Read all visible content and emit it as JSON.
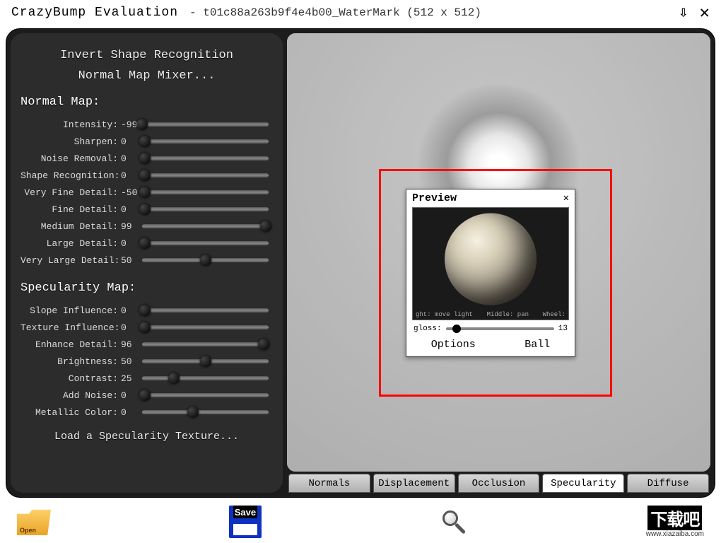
{
  "title": {
    "app": "CrazyBump Evaluation",
    "file": "- t01c88a263b9f4e4b00_WaterMark (512 x 512)"
  },
  "left": {
    "btn_invert": "Invert Shape Recognition",
    "btn_mixer": "Normal Map Mixer...",
    "section_normal": "Normal Map:",
    "section_spec": "Specularity Map:",
    "load_tex": "Load a Specularity Texture...",
    "normal_sliders": [
      {
        "label": "Intensity:",
        "val": "-99",
        "pct": 0
      },
      {
        "label": "Sharpen:",
        "val": "0",
        "pct": 2
      },
      {
        "label": "Noise Removal:",
        "val": "0",
        "pct": 2
      },
      {
        "label": "Shape Recognition:",
        "val": "0",
        "pct": 2
      },
      {
        "label": "Very Fine Detail:",
        "val": "-50",
        "pct": 2
      },
      {
        "label": "Fine Detail:",
        "val": "0",
        "pct": 2
      },
      {
        "label": "Medium Detail:",
        "val": "99",
        "pct": 98
      },
      {
        "label": "Large Detail:",
        "val": "0",
        "pct": 2
      },
      {
        "label": "Very Large Detail:",
        "val": "50",
        "pct": 50
      }
    ],
    "spec_sliders": [
      {
        "label": "Slope Influence:",
        "val": "0",
        "pct": 2
      },
      {
        "label": "Texture Influence:",
        "val": "0",
        "pct": 2
      },
      {
        "label": "Enhance Detail:",
        "val": "96",
        "pct": 96
      },
      {
        "label": "Brightness:",
        "val": "50",
        "pct": 50
      },
      {
        "label": "Contrast:",
        "val": "25",
        "pct": 25
      },
      {
        "label": "Add Noise:",
        "val": "0",
        "pct": 2
      },
      {
        "label": "Metallic Color:",
        "val": "0",
        "pct": 40
      }
    ]
  },
  "preview": {
    "title": "Preview",
    "hint_left": "ght: move light",
    "hint_mid": "Middle: pan",
    "hint_right": "Wheel:",
    "gloss_label": "gloss:",
    "gloss_val": "13",
    "btn_options": "Options",
    "btn_ball": "Ball"
  },
  "tabs": [
    {
      "label": "Normals",
      "active": false
    },
    {
      "label": "Displacement",
      "active": false
    },
    {
      "label": "Occlusion",
      "active": false
    },
    {
      "label": "Specularity",
      "active": true
    },
    {
      "label": "Diffuse",
      "active": false
    }
  ],
  "bottom": {
    "save_label": "Save"
  },
  "watermark": {
    "title": "下载吧",
    "url": "www.xiazaiba.com"
  }
}
